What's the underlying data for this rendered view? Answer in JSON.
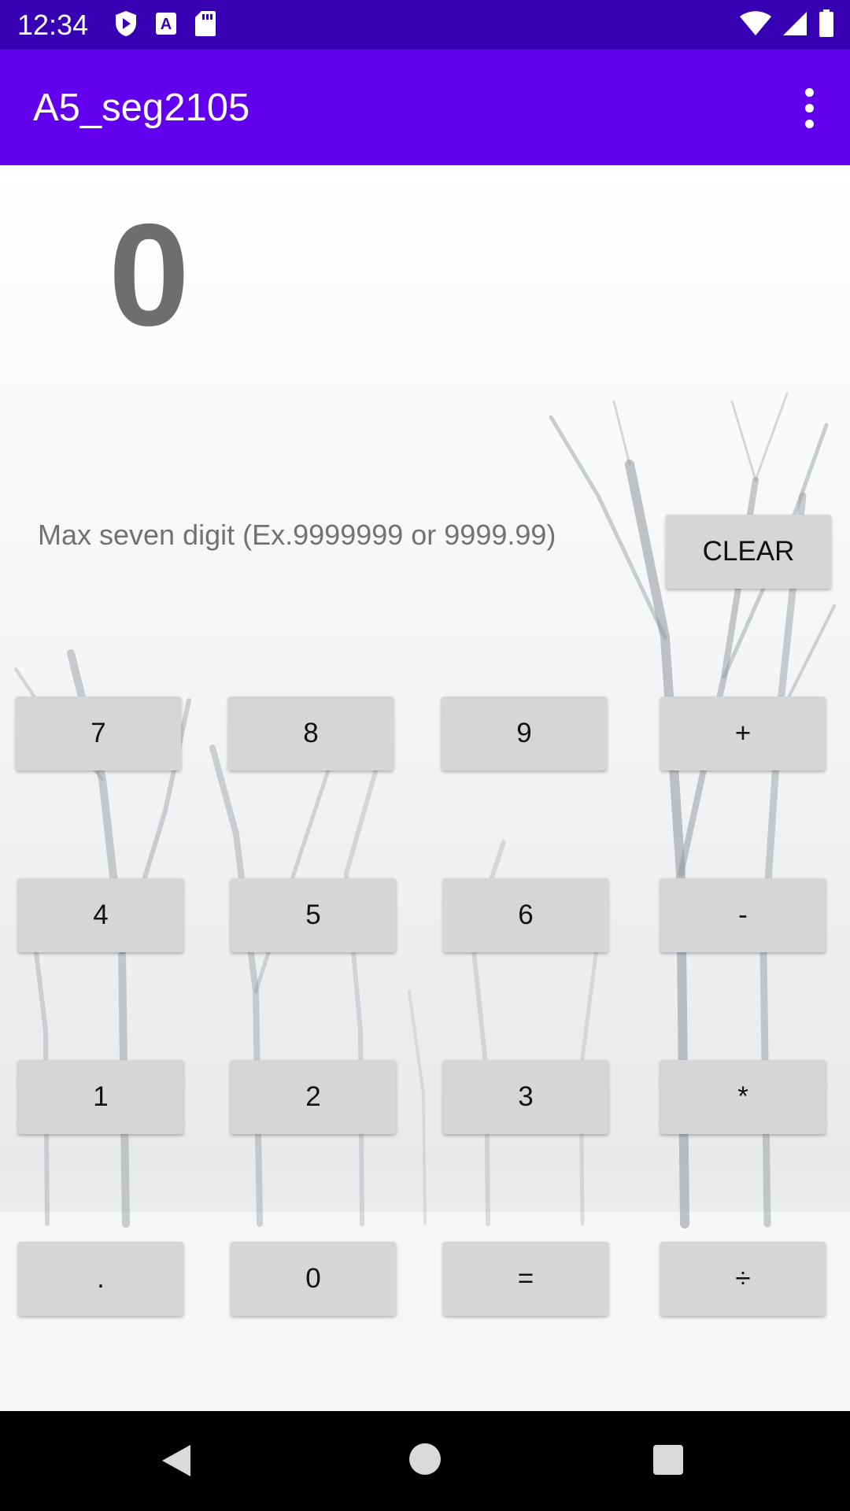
{
  "status_bar": {
    "time": "12:34",
    "left_icons": [
      "play-protect-icon",
      "text-a-icon",
      "sd-card-icon"
    ],
    "right_icons": [
      "wifi-icon",
      "cell-signal-icon",
      "battery-icon"
    ]
  },
  "app_bar": {
    "title": "A5_seg2105",
    "overflow_icon": "more-vert-icon"
  },
  "calculator": {
    "display": "0",
    "hint": "Max seven digit (Ex.9999999 or 9999.99)",
    "clear_label": "CLEAR",
    "keys": {
      "seven": "7",
      "eight": "8",
      "nine": "9",
      "plus": "+",
      "four": "4",
      "five": "5",
      "six": "6",
      "minus": "-",
      "one": "1",
      "two": "2",
      "three": "3",
      "multiply": "*",
      "dot": ".",
      "zero": "0",
      "equals": "=",
      "divide": "÷"
    }
  },
  "nav_bar": {
    "icons": [
      "back-icon",
      "home-icon",
      "recents-icon"
    ]
  },
  "colors": {
    "status_bar": "#3700b3",
    "app_bar": "#6200ee",
    "button": "#d6d6d6",
    "display_text": "#6e6e6e"
  }
}
